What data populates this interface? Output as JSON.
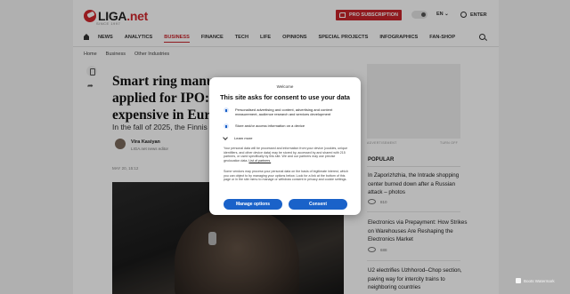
{
  "header": {
    "logo_text": "LIGA",
    "logo_suffix": ".net",
    "logo_sub": "SINCE 1997",
    "pro_label": "PRO SUBSCRIPTION",
    "lang": "EN",
    "enter": "ENTER"
  },
  "nav": {
    "items": [
      "NEWS",
      "ANALYTICS",
      "BUSINESS",
      "FINANCE",
      "TECH",
      "LIFE",
      "OPINIONS",
      "SPECIAL PROJECTS",
      "INFOGRAPHICS",
      "FAN-SHOP"
    ],
    "active": "BUSINESS"
  },
  "breadcrumb": [
    "Home",
    "Business",
    "Other Industries"
  ],
  "article": {
    "headline_lines": [
      "Smart ring manu",
      "applied for IPO:",
      "expensive in Euro"
    ],
    "lead": "In the fall of 2025, the Finnis",
    "author_name": "Vira Kasiyan",
    "author_role": "LIGA.net news editor",
    "date": "MAY 20, 15:12"
  },
  "sidebar": {
    "ad_left": "ADVERTISEMENT",
    "ad_right": "TURN OFF",
    "popular_title": "POPULAR",
    "items": [
      {
        "title": "In Zaporizhzhia, the Intrade shopping center burned down after a Russian attack – photos",
        "views": "810"
      },
      {
        "title": "Electronics via Prepayment: How Strikes on Warehouses Are Reshaping the Electronics Market",
        "views": "688"
      },
      {
        "title": "U2 electrifies Uzhhorod–Chop section, paving way for intercity trains to neighboring countries",
        "views": ""
      }
    ]
  },
  "consent": {
    "welcome": "Welcome",
    "title": "This site asks for consent to use your data",
    "purposes": [
      "Personalised advertising and content, advertising and content measurement, audience research and services development",
      "Store and/or access information on a device"
    ],
    "learn_more": "Learn more",
    "para1": "Your personal data will be processed and information from your device (cookies, unique identifiers, and other device data) may be stored by, accessed by and shared with 215 partners, or used specifically by this site. We and our partners may use precise geolocation data.",
    "para1_link": "List of partners.",
    "para2": "Some vendors may process your personal data on the basis of legitimate interest, which you can object to by managing your options below. Look for a link at the bottom of this page or in the site menu to manage or withdraw consent in privacy and cookie settings.",
    "manage_label": "Manage options",
    "consent_label": "Consent"
  },
  "watermark": "Boots Watermark",
  "colors": {
    "brand_red": "#c8252c",
    "consent_blue": "#1a62c9"
  }
}
